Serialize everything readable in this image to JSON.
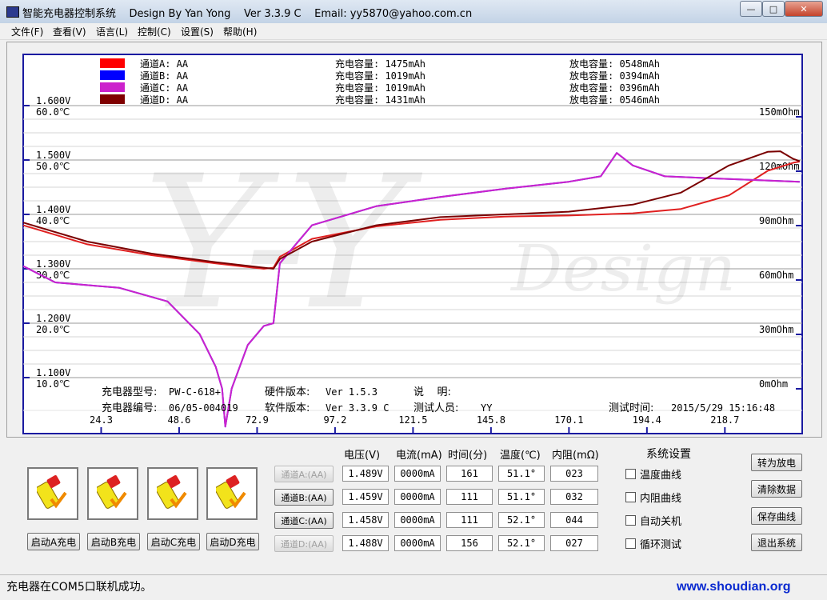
{
  "window": {
    "title": "智能充电器控制系统    Design By Yan Yong    Ver 3.3.9 C    Email: yy5870@yahoo.com.cn",
    "controls": {
      "minimize": "—",
      "maximize": "□",
      "close": "✕"
    }
  },
  "menu": [
    "文件(F)",
    "查看(V)",
    "语言(L)",
    "控制(C)",
    "设置(S)",
    "帮助(H)"
  ],
  "legend": [
    {
      "label": "通道A: AA",
      "color": "#ff0000",
      "charge": "充电容量: 1475mAh",
      "discharge": "放电容量: 0548mAh"
    },
    {
      "label": "通道B: AA",
      "color": "#0000ff",
      "charge": "充电容量: 1019mAh",
      "discharge": "放电容量: 0394mAh"
    },
    {
      "label": "通道C: AA",
      "color": "#cc22cc",
      "charge": "充电容量: 1019mAh",
      "discharge": "放电容量: 0396mAh"
    },
    {
      "label": "通道D: AA",
      "color": "#800000",
      "charge": "充电容量: 1431mAh",
      "discharge": "放电容量: 0546mAh"
    }
  ],
  "chart_data": {
    "type": "line",
    "y_left_voltage_ticks": [
      "1.600V",
      "1.500V",
      "1.400V",
      "1.300V",
      "1.200V",
      "1.100V"
    ],
    "y_left_voltage_range": [
      1.05,
      1.65
    ],
    "y_left_temp_ticks": [
      "60.0℃",
      "50.0℃",
      "40.0℃",
      "30.0℃",
      "20.0℃",
      "10.0℃"
    ],
    "y_right_ticks": [
      "150mOhm",
      "120mOhm",
      "90mOhm",
      "60mOhm",
      "30mOhm",
      "0mOhm"
    ],
    "x_ticks": [
      "24.3",
      "48.6",
      "72.9",
      "97.2",
      "121.5",
      "145.8",
      "170.1",
      "194.4",
      "218.7"
    ],
    "x_range": [
      0,
      242.8
    ],
    "series": [
      {
        "name": "通道A",
        "color": "#e02020",
        "x": [
          0,
          20,
          40,
          60,
          75,
          78,
          80,
          90,
          110,
          130,
          150,
          170,
          190,
          205,
          220,
          232,
          240,
          242
        ],
        "y": [
          1.38,
          1.345,
          1.325,
          1.31,
          1.3,
          1.302,
          1.322,
          1.355,
          1.378,
          1.39,
          1.396,
          1.398,
          1.402,
          1.41,
          1.435,
          1.48,
          1.495,
          1.497
        ]
      },
      {
        "name": "通道B",
        "color": "#1a1aff",
        "x": [
          0,
          10,
          30,
          45,
          55,
          60,
          62,
          63,
          65,
          70,
          75,
          78,
          80,
          90,
          110,
          130,
          150,
          170,
          180,
          185,
          190,
          200,
          220,
          242
        ],
        "y": [
          1.305,
          1.275,
          1.265,
          1.24,
          1.18,
          1.12,
          1.08,
          1.01,
          1.08,
          1.16,
          1.195,
          1.2,
          1.31,
          1.38,
          1.415,
          1.432,
          1.447,
          1.46,
          1.47,
          1.513,
          1.49,
          1.47,
          1.465,
          1.46
        ]
      },
      {
        "name": "通道C",
        "color": "#cc22cc",
        "x": [
          0,
          10,
          30,
          45,
          55,
          60,
          62,
          63,
          65,
          70,
          75,
          78,
          80,
          90,
          110,
          130,
          150,
          170,
          180,
          185,
          190,
          200,
          220,
          242
        ],
        "y": [
          1.305,
          1.275,
          1.265,
          1.24,
          1.18,
          1.12,
          1.08,
          1.01,
          1.08,
          1.16,
          1.195,
          1.2,
          1.31,
          1.38,
          1.415,
          1.432,
          1.447,
          1.46,
          1.47,
          1.513,
          1.49,
          1.47,
          1.465,
          1.46
        ]
      },
      {
        "name": "通道D",
        "color": "#7a0000",
        "x": [
          0,
          20,
          40,
          60,
          75,
          78,
          80,
          90,
          110,
          130,
          150,
          170,
          190,
          205,
          220,
          232,
          236,
          240,
          242
        ],
        "y": [
          1.385,
          1.35,
          1.328,
          1.312,
          1.302,
          1.3,
          1.318,
          1.35,
          1.38,
          1.395,
          1.4,
          1.405,
          1.418,
          1.44,
          1.49,
          1.515,
          1.516,
          1.502,
          1.498
        ]
      }
    ]
  },
  "info": {
    "model_label": "充电器型号:",
    "model_value": "PW-C-618+",
    "hw_label": "硬件版本:",
    "hw_value": "Ver 1.5.3",
    "note_label": "说    明:",
    "serial_label": "充电器编号:",
    "serial_value": "06/05-004019",
    "sw_label": "软件版本:",
    "sw_value": "Ver 3.3.9 C",
    "tester_label": "测试人员:",
    "tester_value": "YY",
    "time_label": "测试时间:",
    "time_value": "2015/5/29 15:16:48"
  },
  "watermark": "Y-Y Design",
  "start_buttons": [
    "启动A充电",
    "启动B充电",
    "启动C充电",
    "启动D充电"
  ],
  "table": {
    "headers": [
      "电压(V)",
      "电流(mA)",
      "时间(分)",
      "温度(℃)",
      "内阻(mΩ)"
    ],
    "rows": [
      {
        "channel": "通道A:(AA)",
        "enabled": false,
        "voltage": "1.489V",
        "current": "0000mA",
        "time": "161",
        "temp": "51.1°",
        "resistance": "023"
      },
      {
        "channel": "通道B:(AA)",
        "enabled": true,
        "voltage": "1.459V",
        "current": "0000mA",
        "time": "111",
        "temp": "51.1°",
        "resistance": "032"
      },
      {
        "channel": "通道C:(AA)",
        "enabled": true,
        "voltage": "1.458V",
        "current": "0000mA",
        "time": "111",
        "temp": "52.1°",
        "resistance": "044"
      },
      {
        "channel": "通道D:(AA)",
        "enabled": false,
        "voltage": "1.488V",
        "current": "0000mA",
        "time": "156",
        "temp": "52.1°",
        "resistance": "027"
      }
    ]
  },
  "settings": {
    "title": "系统设置",
    "options": [
      {
        "label": "温度曲线",
        "checked": false
      },
      {
        "label": "内阻曲线",
        "checked": false
      },
      {
        "label": "自动关机",
        "checked": false
      },
      {
        "label": "循环测试",
        "checked": false
      }
    ]
  },
  "side_buttons": [
    "转为放电",
    "清除数据",
    "保存曲线",
    "退出系统"
  ],
  "status": "充电器在COM5口联机成功。",
  "site_watermark": "www.shoudian.org"
}
